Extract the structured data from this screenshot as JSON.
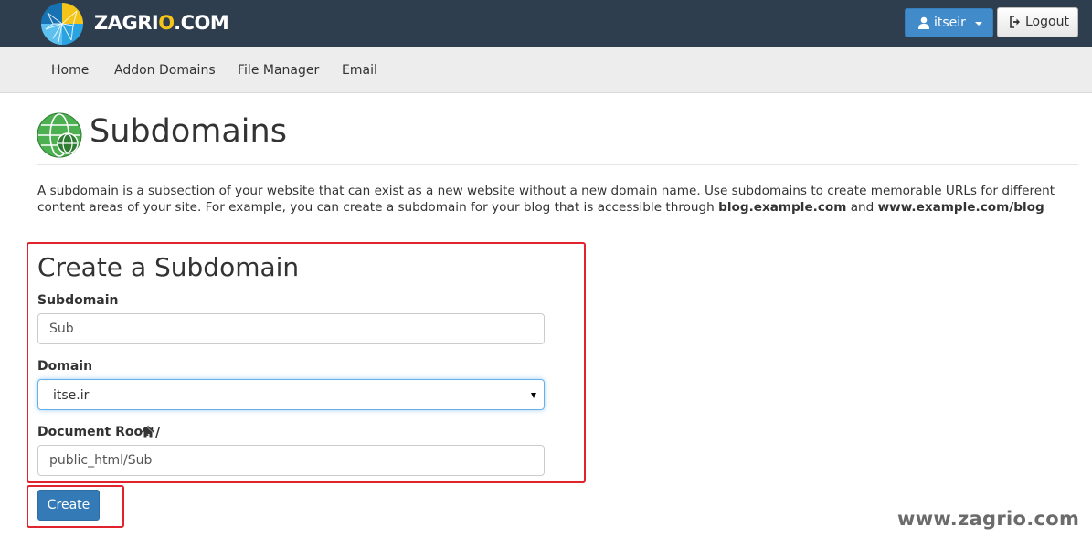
{
  "brand": {
    "name_part1": "ZAGRI",
    "name_o": "O",
    "name_part2": ".COM",
    "accent": "#f4c419"
  },
  "header": {
    "user_label": "itseir",
    "logout_label": "Logout"
  },
  "nav": {
    "items": [
      {
        "label": "Home"
      },
      {
        "label": "Addon Domains"
      },
      {
        "label": "File Manager"
      },
      {
        "label": "Email"
      }
    ]
  },
  "page": {
    "title": "Subdomains",
    "description_1": "A subdomain is a subsection of your website that can exist as a new website without a new domain name. Use subdomains to create memorable URLs for different content areas of your site. For example, you can create a subdomain for your blog that is accessible through ",
    "description_bold_1": "blog.example.com",
    "description_2": " and ",
    "description_bold_2": "www.example.com/blog"
  },
  "form": {
    "title": "Create a Subdomain",
    "subdomain_label": "Subdomain",
    "subdomain_value": "Sub",
    "domain_label": "Domain",
    "domain_value": "itse.ir",
    "docroot_label": "Document Root",
    "docroot_slash": "/",
    "docroot_value": "public_html/Sub",
    "create_label": "Create"
  },
  "watermark": "www.zagrio.com",
  "colors": {
    "topbar": "#2f3e4e",
    "primary_button": "#337ab7",
    "highlight_border": "#e0232c"
  }
}
